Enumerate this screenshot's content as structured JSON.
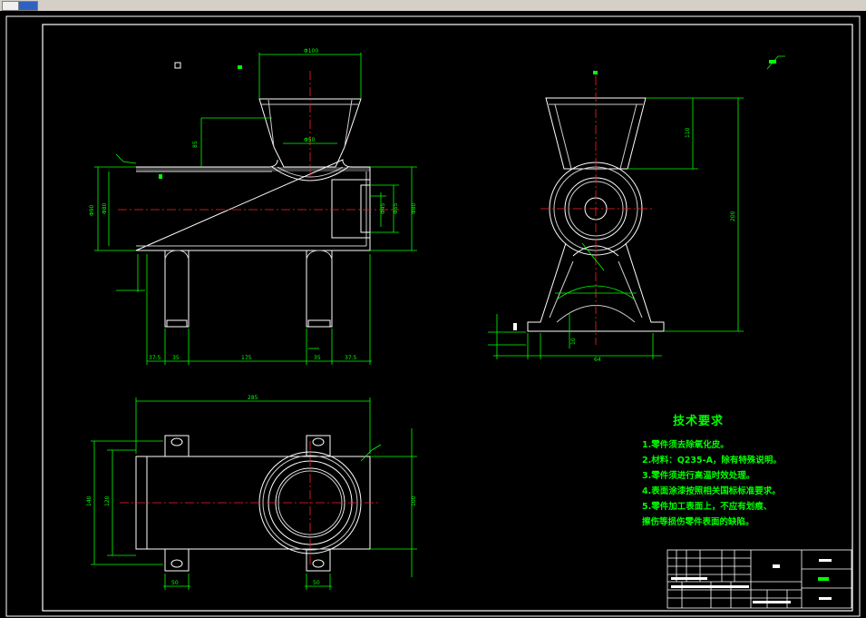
{
  "toolbar": {
    "tab1": "",
    "tab2": ""
  },
  "technical_requirements": {
    "title": "技术要求",
    "items": [
      "1.零件须去除氧化皮。",
      "2.材料：Q235-A，除有特殊说明。",
      "3.零件须进行高温时效处理。",
      "4.表面涂漆按照相关国标标准要求。",
      "5.零件加工表面上，不应有划痕、",
      "擦伤等损伤零件表面的缺陷。"
    ]
  },
  "dimensions": {
    "feed_mouth_width": "Φ100",
    "feed_neck_width": "Φ50",
    "front_height_1": "85",
    "bore_dia": "Φ80",
    "barrel_height": "Φ90",
    "outlet_dia_1": "Φ55",
    "outlet_dia_2": "Φ45",
    "outlet_dia_3": "Φ80",
    "leg_1": "37.5",
    "leg_2": "35",
    "leg_span": "175",
    "leg_3": "35",
    "leg_4": "37.5",
    "side_height_1": "110",
    "side_height_2": "200",
    "side_dim_1": "10",
    "side_dim_2": "64",
    "plan_length": "285",
    "plan_width_1": "140",
    "plan_width_2": "120",
    "plan_height": "100",
    "plan_foot_1": "50",
    "plan_foot_2": "50"
  }
}
